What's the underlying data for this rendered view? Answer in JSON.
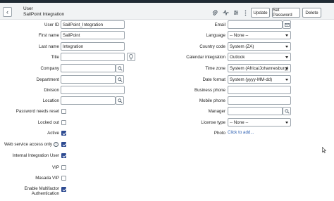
{
  "header": {
    "record_type": "User",
    "record_name": "SailPoint Integration",
    "buttons": {
      "update": "Update",
      "set_password": "Set Password",
      "delete": "Delete"
    }
  },
  "left_fields": {
    "user_id": {
      "label": "User ID",
      "value": "SailPoint_Integration"
    },
    "first_name": {
      "label": "First name",
      "value": "SailPoint"
    },
    "last_name": {
      "label": "Last name",
      "value": "Integration"
    },
    "title": {
      "label": "Title",
      "value": ""
    },
    "company": {
      "label": "Company",
      "value": ""
    },
    "department": {
      "label": "Department",
      "value": ""
    },
    "division": {
      "label": "Division",
      "value": ""
    },
    "location": {
      "label": "Location",
      "value": ""
    }
  },
  "checkboxes": {
    "password_needs_reset": {
      "label": "Password needs reset",
      "checked": false
    },
    "locked_out": {
      "label": "Locked out",
      "checked": false
    },
    "active": {
      "label": "Active",
      "checked": true
    },
    "web_service_access_only": {
      "label": "Web service access only",
      "checked": true
    },
    "internal_integration_user": {
      "label": "Internal Integration User",
      "checked": true
    },
    "vip": {
      "label": "VIP",
      "checked": false
    },
    "masada_vip": {
      "label": "Masada VIP",
      "checked": false
    },
    "enable_mfa": {
      "label_line1": "Enable Multifactor",
      "label_line2": "Authentication",
      "checked": true
    }
  },
  "right_fields": {
    "email": {
      "label": "Email",
      "value": ""
    },
    "language": {
      "label": "Language",
      "value": "-- None --"
    },
    "country_code": {
      "label": "Country code",
      "value": "System (ZA)"
    },
    "calendar_integration": {
      "label": "Calendar integration",
      "value": "Outlook"
    },
    "time_zone": {
      "label": "Time zone",
      "value": "System (Africa/Johannesburg)"
    },
    "date_format": {
      "label": "Date format",
      "value": "System (yyyy-MM-dd)"
    },
    "business_phone": {
      "label": "Business phone",
      "value": ""
    },
    "mobile_phone": {
      "label": "Mobile phone",
      "value": ""
    },
    "manager": {
      "label": "Manager",
      "value": ""
    },
    "license_type": {
      "label": "License type",
      "value": "-- None --"
    },
    "photo": {
      "label": "Photo",
      "link": "Click to add..."
    }
  },
  "colors": {
    "accent": "#2d4a91",
    "link": "#2a5db0",
    "header_bg": "#f1f3f4",
    "topbar": "#1f2a33"
  }
}
